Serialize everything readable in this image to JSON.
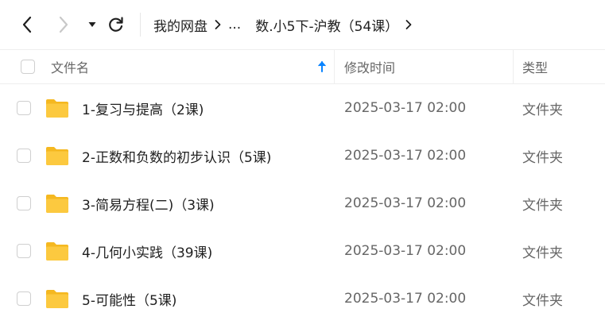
{
  "breadcrumb": {
    "root": "我的网盘",
    "ellipsis": "...",
    "current": "数.小5下-沪教（54课）"
  },
  "table": {
    "columns": {
      "name": "文件名",
      "modified": "修改时间",
      "type": "类型"
    },
    "sort": {
      "column": "name",
      "direction": "ascending"
    },
    "rows": [
      {
        "name": "1-复习与提高（2课)",
        "modified": "2025-03-17 02:00",
        "type": "文件夹"
      },
      {
        "name": "2-正数和负数的初步认识（5课)",
        "modified": "2025-03-17 02:00",
        "type": "文件夹"
      },
      {
        "name": "3-简易方程(二)（3课)",
        "modified": "2025-03-17 02:00",
        "type": "文件夹"
      },
      {
        "name": "4-几何小实践（39课)",
        "modified": "2025-03-17 02:00",
        "type": "文件夹"
      },
      {
        "name": "5-可能性（5课)",
        "modified": "2025-03-17 02:00",
        "type": "文件夹"
      }
    ]
  },
  "colors": {
    "folder": "#fcc93f",
    "folder_dark": "#f5b820",
    "accent": "#0a84ff",
    "icon_disabled": "#c8c8c8",
    "icon_active": "#1f1f1f"
  },
  "icons": {
    "back": "chevron-left-icon",
    "forward": "chevron-right-icon",
    "dropdown": "caret-down-icon",
    "refresh": "refresh-icon",
    "sort": "arrow-up-icon",
    "folder": "folder-icon"
  }
}
